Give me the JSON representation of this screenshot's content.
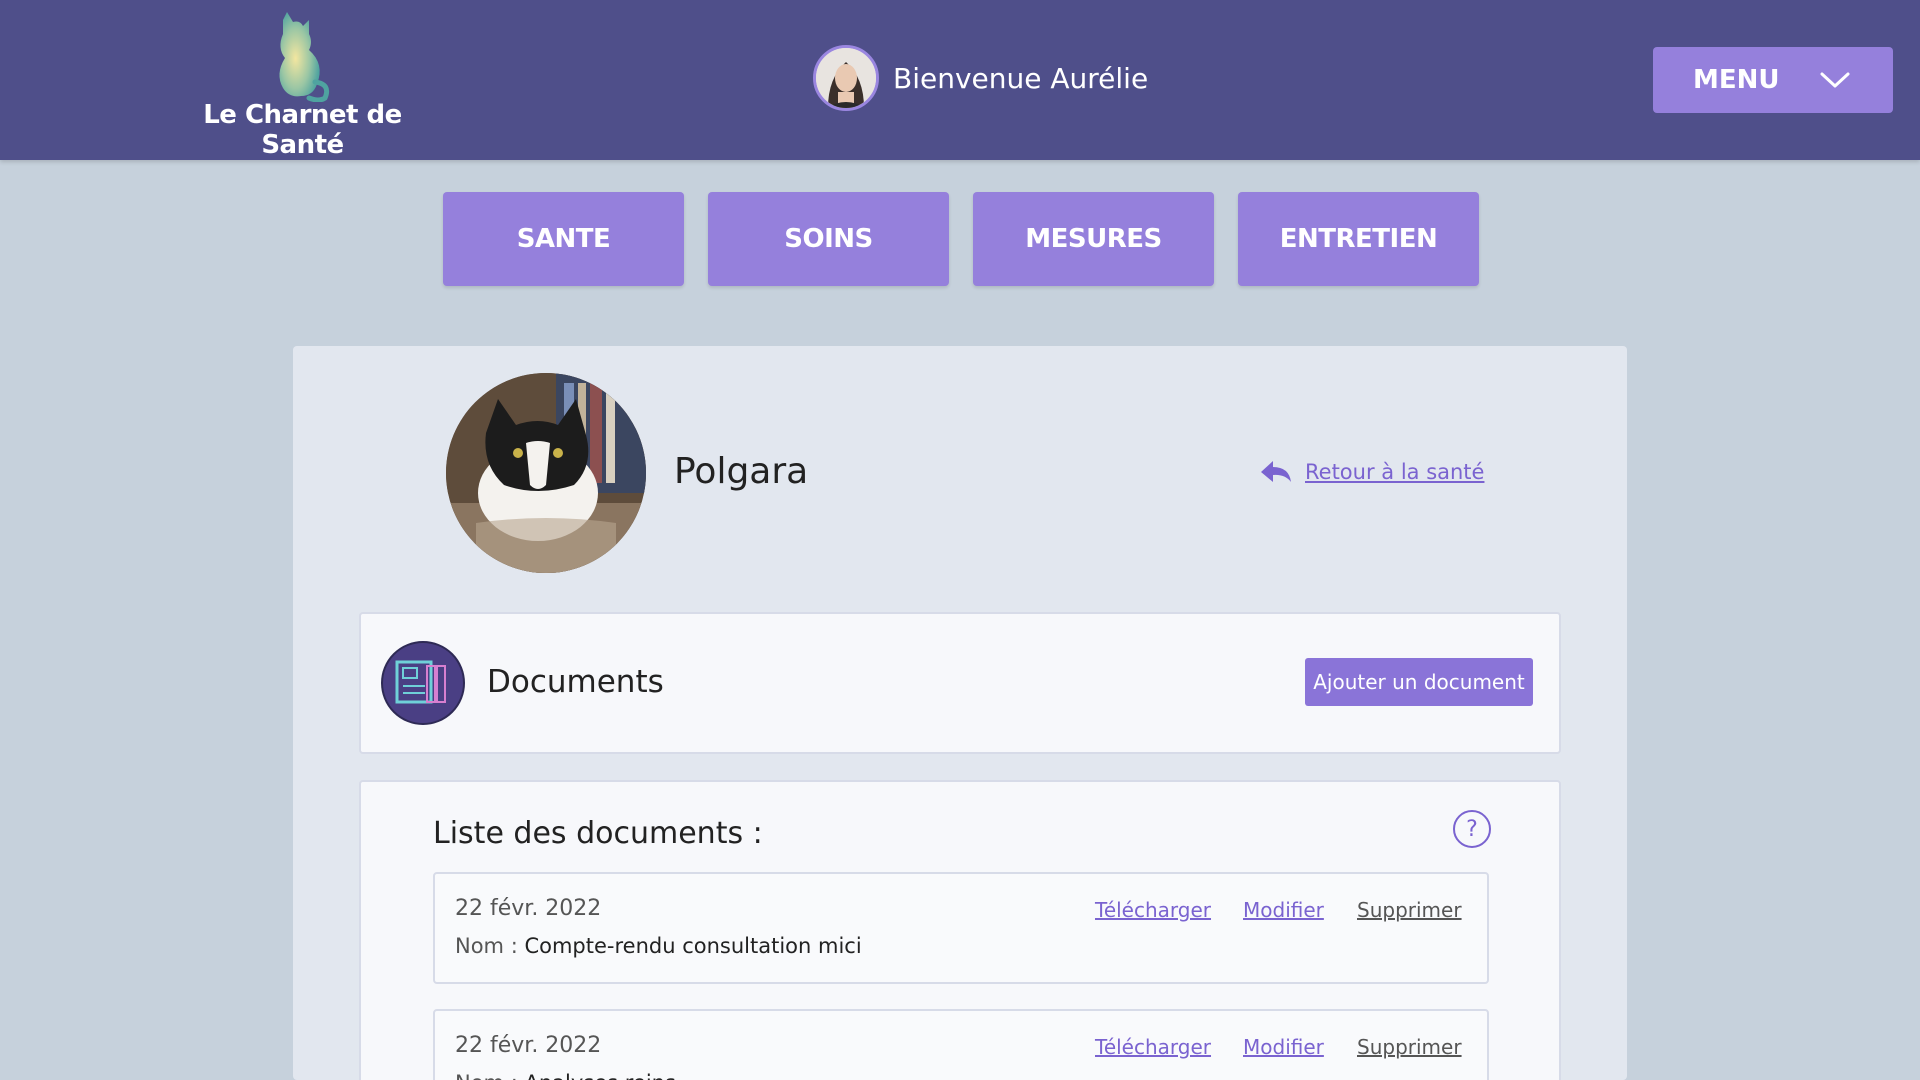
{
  "header": {
    "app_name": "Le Charnet de Santé",
    "welcome": "Bienvenue Aurélie",
    "menu_label": "MENU"
  },
  "tabs": [
    {
      "label": "SANTE"
    },
    {
      "label": "SOINS"
    },
    {
      "label": "MESURES"
    },
    {
      "label": "ENTRETIEN"
    }
  ],
  "pet": {
    "name": "Polgara",
    "back_link": "Retour à la santé"
  },
  "documents_panel": {
    "title": "Documents",
    "add_button": "Ajouter un document"
  },
  "list": {
    "title": "Liste des documents :",
    "help_symbol": "?",
    "name_prefix": "Nom : ",
    "actions": {
      "download": "Télécharger",
      "edit": "Modifier",
      "delete": "Supprimer"
    },
    "items": [
      {
        "date": "22 févr. 2022",
        "name": "Compte-rendu consultation mici"
      },
      {
        "date": "22 févr. 2022",
        "name": "Analyses reins"
      }
    ]
  },
  "colors": {
    "header_bg": "#4f4f8a",
    "accent": "#9580dc",
    "page_bg": "#c6d1dc",
    "link": "#7a63d0"
  }
}
